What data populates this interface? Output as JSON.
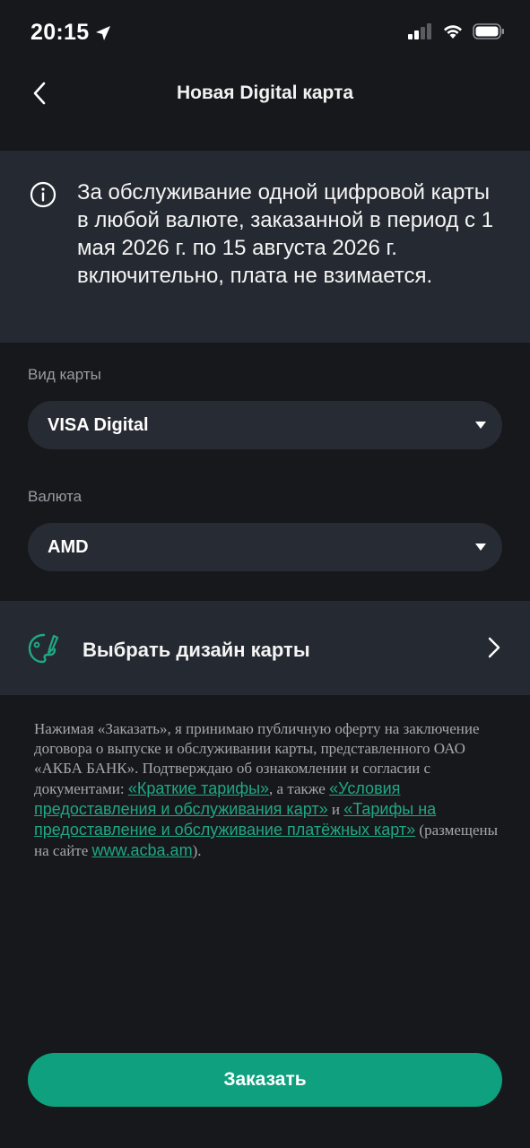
{
  "status_bar": {
    "time": "20:15",
    "icons": [
      "location-arrow-icon",
      "cellular-signal-icon",
      "wifi-icon",
      "battery-icon"
    ]
  },
  "nav": {
    "title": "Новая Digital карта",
    "back_icon": "chevron-left-icon"
  },
  "info_banner": {
    "icon": "info-circle-icon",
    "text": "За обслуживание одной цифровой карты в любой валюте, заказанной в период с 1 мая 2026 г. по 15 августа 2026 г. включительно, плата не взимается."
  },
  "form": {
    "card_type": {
      "label": "Вид карты",
      "value": "VISA Digital"
    },
    "currency": {
      "label": "Валюта",
      "value": "AMD"
    }
  },
  "design": {
    "icon": "palette-icon",
    "label": "Выбрать дизайн карты",
    "chevron_icon": "chevron-right-icon"
  },
  "legal": {
    "part1": "Нажимая «Заказать», я принимаю публичную оферту на заключение договора о выпуске и обслуживании карты, представленного ОАО «АКБА БАНК». Подтверждаю об ознакомлении и согласии с документами: ",
    "link1": "«Краткие тарифы»",
    "part2": ", а также ",
    "link2": "«Условия предоставления и обслуживания карт»",
    "part3": " и ",
    "link3": "«Тарифы на предоставление и обслуживание платёжных карт»",
    "part4": " (размещены на сайте ",
    "link4": "www.acba.am",
    "part5": ")."
  },
  "order_button": {
    "label": "Заказать"
  },
  "colors": {
    "background": "#17181c",
    "panel": "#252a32",
    "field": "#272b33",
    "accent": "#0fa07f",
    "link": "#1fa885",
    "muted_text": "#9a9ca3"
  }
}
